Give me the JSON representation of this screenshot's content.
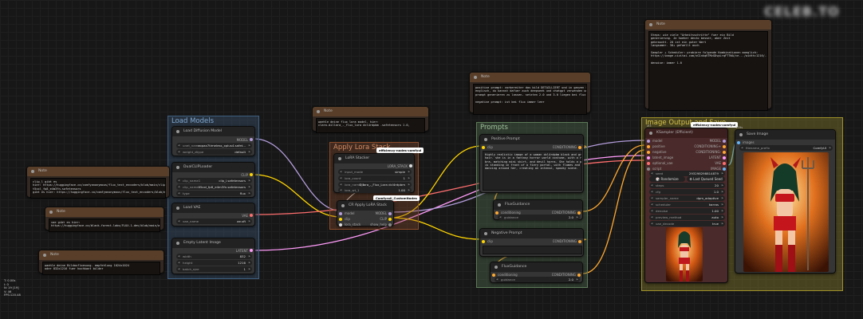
{
  "stats": {
    "lines": [
      "T: 0.00s",
      "I: 0",
      "N: 19 [19]",
      "V: 46",
      "FPS:120.48"
    ]
  },
  "watermark": "CELEB.TO",
  "groups": {
    "load_models": "Load Models",
    "apply_lora": "Apply Lora Stack",
    "prompts": "Prompts",
    "image_output": "Image Output and Save"
  },
  "notes": {
    "clip": {
      "title": "Note",
      "text": "clip_l gibt es\nhier: https://huggingface.co/comfyanonymous/flux_text_encoders/blob/main/clip_l.safetensors\nt5xxl_fp8_e4m3fn.safetensors\ngibt es hier: https://huggingface.co/comfyanonymous/flux_text_encoders/blob/main/t5xxl_fp8_e4m3fn.safetensors"
    },
    "vae": {
      "title": "Note",
      "text": "vae gibt es hier:\nhttps://huggingface.co/black-forest-labs/FLUX.1-dev/blob/main/ae.safetensors"
    },
    "latent": {
      "title": "Note",
      "text": "waehle deine Bildaufloesung. empfehlung 1024x1024\noder 832x1216 fuer hochkant bilder"
    },
    "lora": {
      "title": "Note",
      "text": "waehle deine flux lora model. hier:\nclara-dillara_-_flux_lora dcl4rdpbm .safetensors 1.0,"
    },
    "prompt": {
      "title": "Note",
      "text": "positive prompt: vorbereiter das bild DETAILLIERT und in ganzen Saetzen auf\nenglisch, du kannst dafuer auch deepseek und chatgpt verwenden um dir einen\nprompt generieren zu lassen. setzten 2.0 und 3.0 liegen bei flux\n\nnegative prompt: ist bei flux immer leer"
    },
    "sampler": {
      "title": "Note",
      "text": "Steps: wie viele \"Arbeitsschritte\" fuer ein Bild\ngenerierung. Je hoeher desto besser, aber Zeit\ngebraucht. 20 ist ein guter Wert\nlangsamer. 30+ gefaellt auch\n\nSampler + Scheduler: probiere folgende Kombinationen moeglich:\nhttps://image.civitai.com/xG1nkqKTMzGDvpLrqFT7WA/ce.../width=1216/...\n\ndenoise: immer 1.0"
    }
  },
  "nodes": {
    "load_diffusion": {
      "title": "Load Diffusion Model",
      "out": "MODEL",
      "unet_name_label": "unet_name",
      "unet_name": "copax7timeless_xplus4.safet...",
      "weight_dtype_label": "weight_dtype",
      "weight_dtype": "default"
    },
    "dual_clip": {
      "title": "DualCLIPLoader",
      "out": "CLIP",
      "clip_name1_label": "clip_name1",
      "clip_name1": "clip_l.safetensors",
      "clip_name2_label": "clip_name2",
      "clip_name2": "t5xxl_fp8_e4m3fn.safetensors",
      "type_label": "type",
      "type": "flux"
    },
    "load_vae": {
      "title": "Load VAE",
      "out": "VAE",
      "vae_name_label": "vae_name",
      "vae_name": "ae.sft"
    },
    "empty_latent": {
      "title": "Empty Latent Image",
      "out": "LATENT",
      "width_label": "width",
      "width": "832",
      "height_label": "height",
      "height": "1216",
      "batch_label": "batch_size",
      "batch": "1"
    },
    "lora_stacker": {
      "title": "LoRA Stacker",
      "badge": "efficiency-nodes-comfyui",
      "out": "LORA_STACK",
      "input_mode_label": "input_mode",
      "input_mode": "simple",
      "lora_count_label": "lora_count",
      "lora_count": "1",
      "lora_name_label": "lora_name_1",
      "lora_name": "Dilara_-_Flux_Lora dcl4rdpbm",
      "lora_wt_label": "lora_wt_1",
      "lora_wt": "1.00"
    },
    "cr_lora": {
      "title": "CR Apply LoRA Stack",
      "badge": "Comfyroll_CustomNodes",
      "in": [
        "model",
        "clip",
        "lora_stack"
      ],
      "out": [
        "MODEL",
        "CLIP",
        "show_help"
      ]
    },
    "positive": {
      "title": "Positive Prompt",
      "in": "clip",
      "out": "CONDITIONING",
      "text": "Highly realistic image of a woman dcl4rdpbm black and green colored\nhair. she is in a fantasy horror world costume, with a red leather\nbra, matching mini skirt, and devil horns. She holds a pitchfork and\nis standing in front of a fiery portal, with flames and shadows\ndancing around her, creating an intense, spooky scene."
    },
    "flux_guidance_pos": {
      "title": "FluxGuidance",
      "in": "conditioning",
      "out": "CONDITIONING",
      "guidance_label": "guidance",
      "guidance": "2.0"
    },
    "negative": {
      "title": "Negative Prompt",
      "in": "clip",
      "out": "CONDITIONING",
      "text": ""
    },
    "flux_guidance_neg": {
      "title": "FluxGuidance",
      "in": "conditioning",
      "out": "CONDITIONING",
      "guidance_label": "guidance",
      "guidance": "2.0"
    },
    "ksampler": {
      "title": "KSampler (Efficient)",
      "badge": "efficiency-nodes-comfyui",
      "in": [
        "model",
        "positive",
        "negative",
        "latent_image",
        "optional_vae",
        "script"
      ],
      "out": [
        "MODEL",
        "CONDITIONING+",
        "CONDITIONING-",
        "LATENT",
        "VAE",
        "IMAGE"
      ],
      "seed_label": "seed",
      "seed": "293298298814879",
      "randomize": "Randomize",
      "last_seed": "Last Queued Seed",
      "steps_label": "steps",
      "steps": "20",
      "cfg_label": "cfg",
      "cfg": "1.0",
      "sampler_label": "sampler_name",
      "sampler": "dpm_adaptive",
      "scheduler_label": "scheduler",
      "scheduler": "karras",
      "denoise_label": "denoise",
      "denoise": "1.00",
      "preview_label": "preview_method",
      "preview": "auto",
      "vae_decode_label": "vae_decode",
      "vae_decode": "true"
    },
    "save_image": {
      "title": "Save Image",
      "chip": "139s",
      "in": "images",
      "prefix_label": "filename_prefix",
      "prefix": "ComfyUI"
    }
  },
  "colors": {
    "load_group": "#3f5f80",
    "lora_group": "#8a4b2a",
    "prompt_group": "#5c7a58",
    "output_group": "#9e8f2a",
    "clip_link": "#ffd500",
    "model_link": "#b39ddb",
    "vae_link": "#ff6e6e",
    "latent_link": "#ff9cf9",
    "cond_link": "#ffa931"
  }
}
